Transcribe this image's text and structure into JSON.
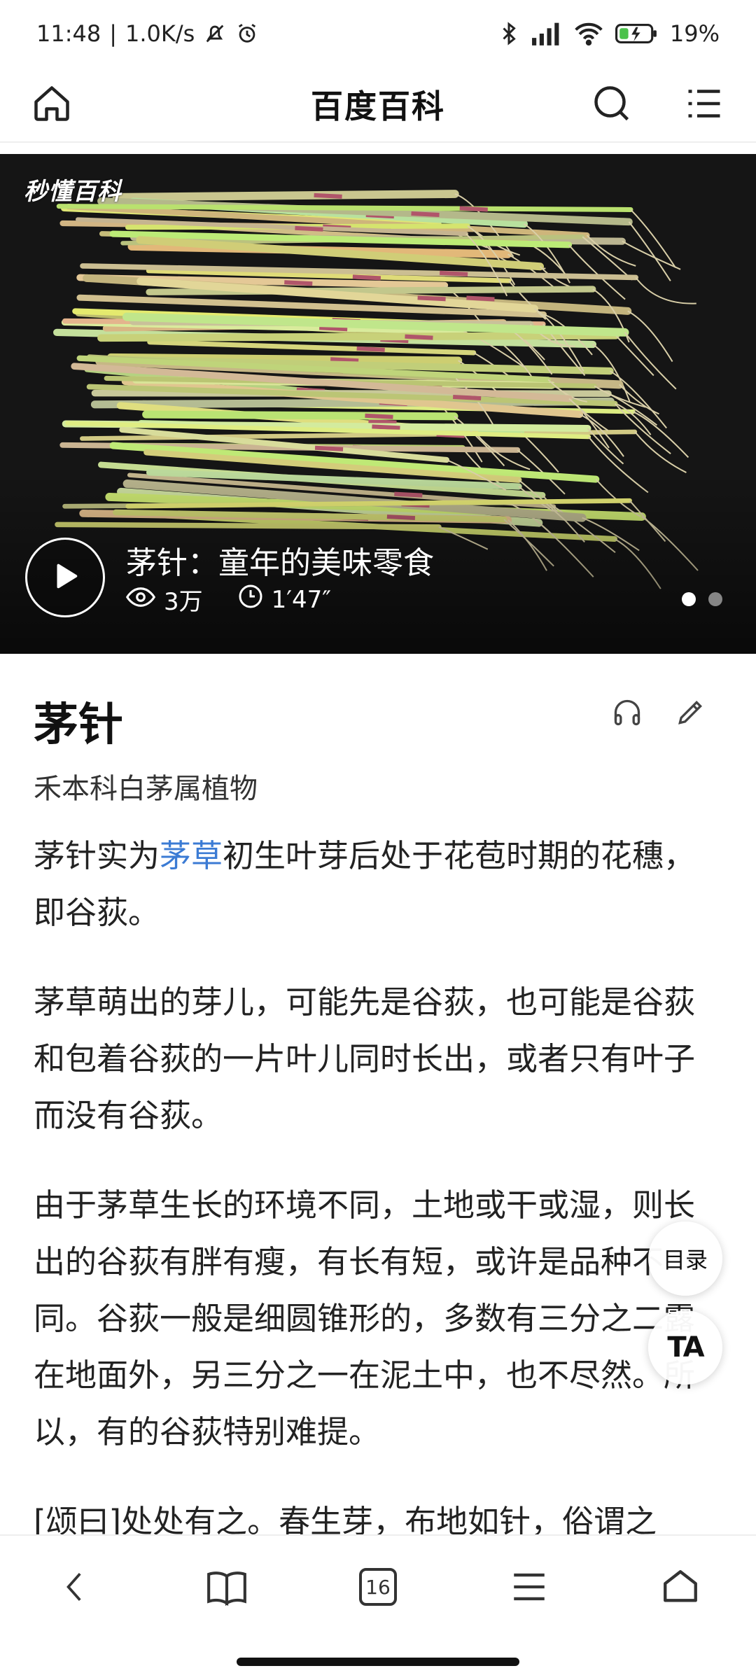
{
  "status_bar": {
    "time": "11:48",
    "net_speed": "1.0K/s",
    "battery_pct": "19%",
    "icons": [
      "mute-icon",
      "alarm-icon",
      "bluetooth-icon",
      "signal-icon",
      "wifi-icon",
      "battery-icon"
    ]
  },
  "header": {
    "title": "百度百科",
    "icons": [
      "home-icon",
      "search-icon",
      "menu-icon"
    ]
  },
  "hero": {
    "watermark": "秒懂百科",
    "video_title": "茅针：童年的美味零食",
    "views": "3万",
    "duration": "1′47″",
    "slide_count": 2,
    "active_slide": 1
  },
  "entry": {
    "title": "茅针",
    "subtitle": "禾本科白茅属植物",
    "action_icons": [
      "listen-icon",
      "edit-icon"
    ]
  },
  "content": {
    "p1_before": "茅针实为",
    "p1_link": "茅草",
    "p1_after": "初生叶芽后处于花苞时期的花穗，即谷荻。",
    "p2": "茅草萌出的芽儿，可能先是谷荻，也可能是谷荻和包着谷荻的一片叶儿同时长出，或者只有叶子而没有谷荻。",
    "p3": "由于茅草生长的环境不同，土地或干或湿，则长出的谷荻有胖有瘦，有长有短，或许是品种不同。谷荻一般是细圆锥形的，多数有三分之二露在地面外，另三分之一在泥土中，也不尽然。所以，有的谷荻特别难提。",
    "p4": "[颂曰]处处有之。春生芽，布地如针，俗谓之"
  },
  "floating": {
    "toc_label": "目录",
    "font_label": "TA"
  },
  "bottom_nav": {
    "tab_count": "16",
    "icons": [
      "back-icon",
      "bookmarks-icon",
      "tabs-icon",
      "menu-icon",
      "home-icon"
    ]
  },
  "colors": {
    "link": "#3b7bd4",
    "text": "#222222",
    "hero_bg": "#151515"
  }
}
